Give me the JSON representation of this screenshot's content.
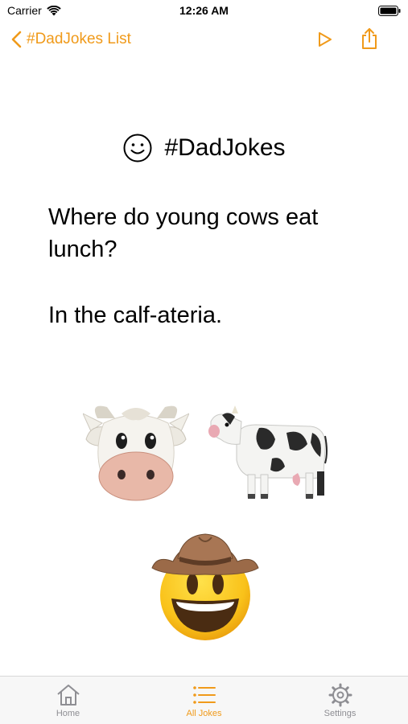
{
  "status_bar": {
    "carrier": "Carrier",
    "time": "12:26 AM"
  },
  "nav": {
    "back_label": "#DadJokes List",
    "icons": [
      "chevron-left-icon",
      "play-icon",
      "share-icon"
    ]
  },
  "content": {
    "title": "#DadJokes",
    "title_icon": "smiley-icon",
    "joke": "Where do young cows eat lunch?",
    "punchline": "In the calf-ateria.",
    "emojis": [
      "cow-face-emoji",
      "cow-emoji",
      "cowboy-emoji"
    ]
  },
  "tab_bar": {
    "tabs": [
      {
        "label": "Home",
        "icon": "home-icon",
        "active": false
      },
      {
        "label": "All Jokes",
        "icon": "list-icon",
        "active": true
      },
      {
        "label": "Settings",
        "icon": "gear-icon",
        "active": false
      }
    ]
  },
  "colors": {
    "accent": "#f09a1a",
    "inactive": "#8e8e93",
    "tab_bar_bg": "#f7f7f7"
  }
}
